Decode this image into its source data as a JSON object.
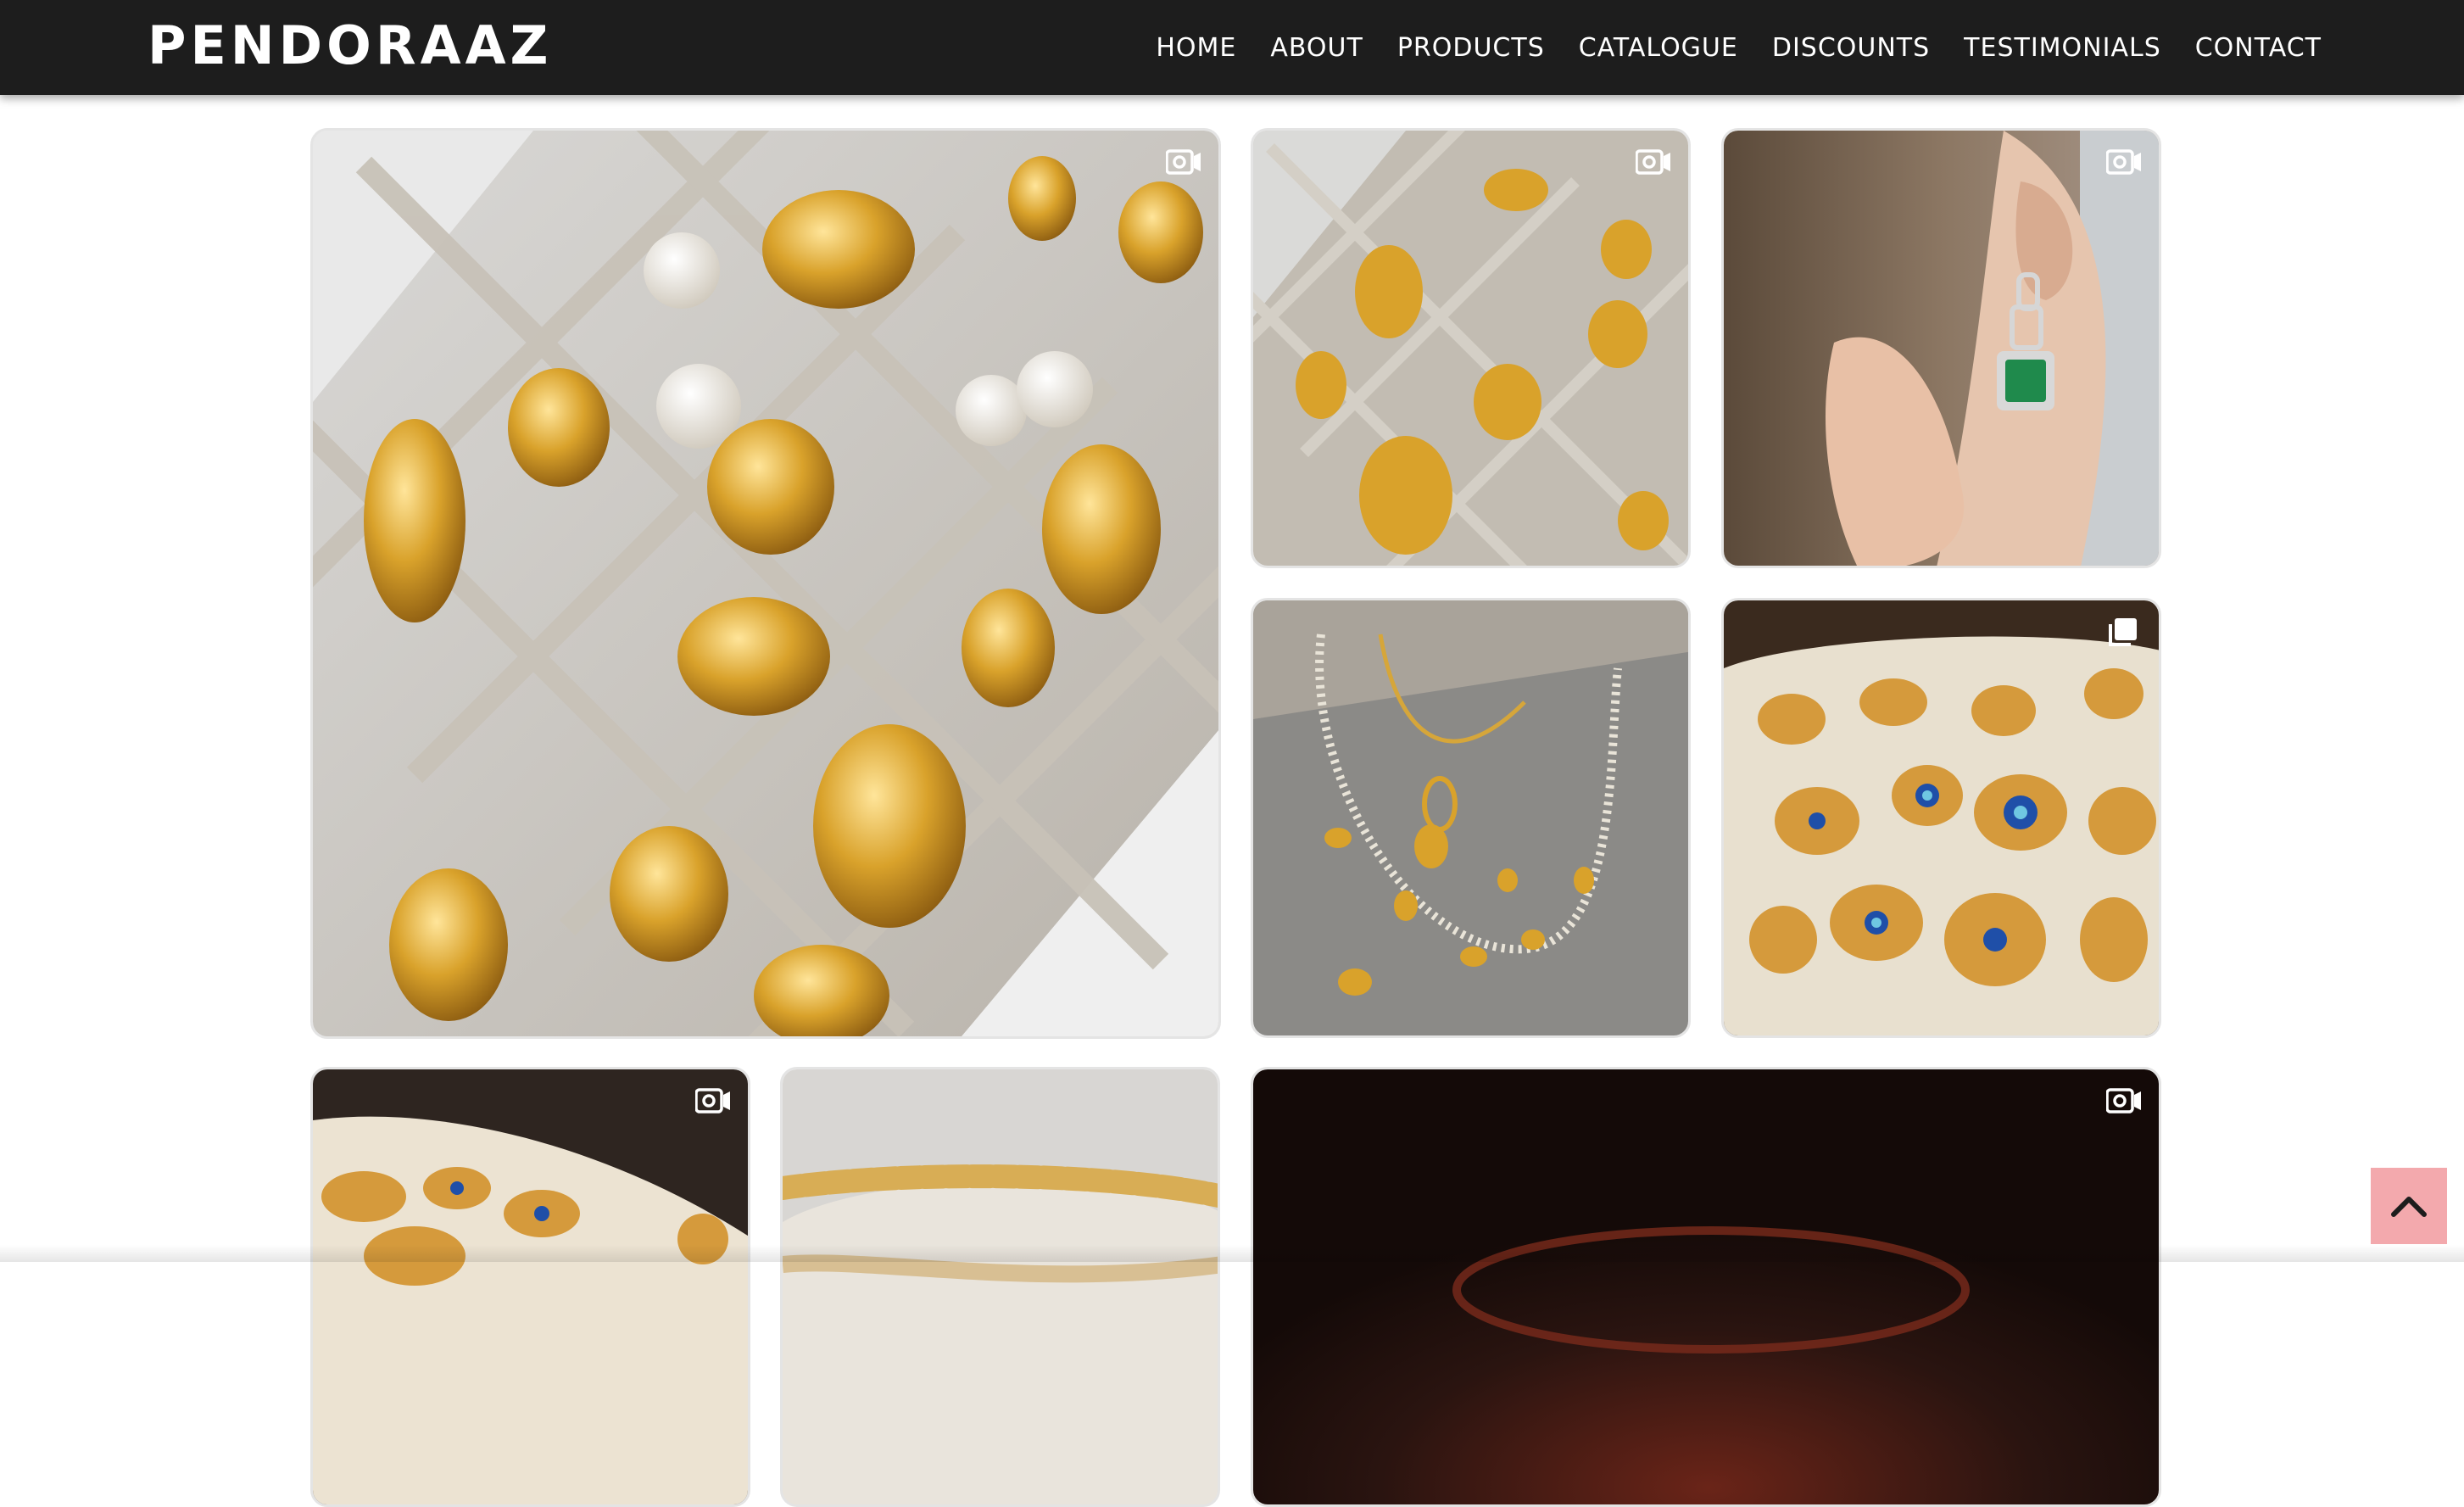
{
  "brand": "PENDORAAZ",
  "nav": {
    "home": "HOME",
    "about": "ABOUT",
    "products": "PRODUCTS",
    "catalogue": "CATALOGUE",
    "discounts": "DISCOUNTS",
    "testimonials": "TESTIMONIALS",
    "contact": "CONTACT"
  },
  "colors": {
    "navbar": "#1d1d1d",
    "nav_text": "#ffffff",
    "scroll_button": "#f3a9ad",
    "tile_border": "#e4e4e4"
  },
  "gallery": [
    {
      "subject": "gold earrings and rings in grey velvet tray",
      "badge": "video-icon"
    },
    {
      "subject": "gold hoops and rings in velvet tray",
      "badge": "video-icon"
    },
    {
      "subject": "green emerald drop earring worn on ear",
      "badge": "video-icon"
    },
    {
      "subject": "evil eye tennis necklace and earring set",
      "badge": "none"
    },
    {
      "subject": "evil eye gold rings on cream tray",
      "badge": "carousel-icon"
    },
    {
      "subject": "evil eye rings close-up",
      "badge": "video-icon"
    },
    {
      "subject": "gold beaded bracelet",
      "badge": "none"
    },
    {
      "subject": "dark reel with red glow",
      "badge": "video-icon"
    }
  ],
  "scroll_top_icon": "chevron-up-icon"
}
